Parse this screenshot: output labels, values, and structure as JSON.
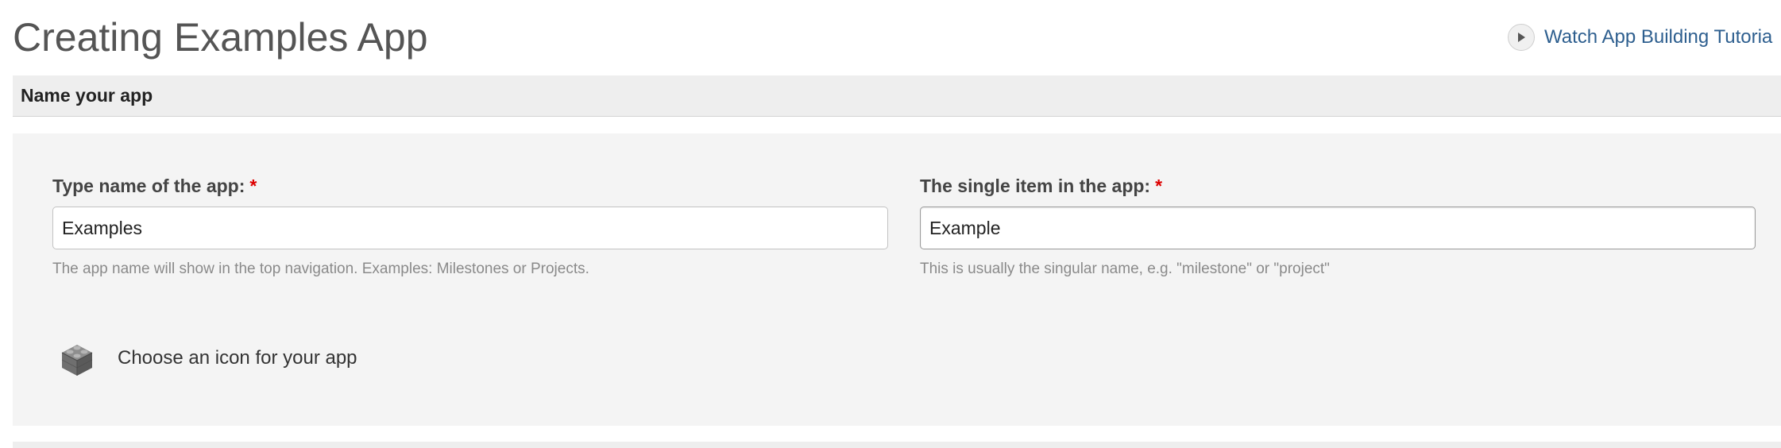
{
  "page": {
    "title": "Creating Examples App",
    "tutorial_link": "Watch App Building Tutoria"
  },
  "section": {
    "title": "Name your app"
  },
  "fields": {
    "app_name": {
      "label": "Type name of the app:",
      "required_marker": "*",
      "value": "Examples",
      "hint": "The app name will show in the top navigation. Examples: Milestones or Projects."
    },
    "item_name": {
      "label": "The single item in the app:",
      "required_marker": "*",
      "value": "Example",
      "hint": "This is usually the singular name, e.g. \"milestone\" or \"project\""
    }
  },
  "icon_chooser": {
    "icon": "lego-brick-icon",
    "label": "Choose an icon for your app"
  },
  "colors": {
    "link": "#2e5f8f",
    "required": "#dd0000",
    "panel_background": "#f4f4f4",
    "header_background": "#eeeeee"
  }
}
